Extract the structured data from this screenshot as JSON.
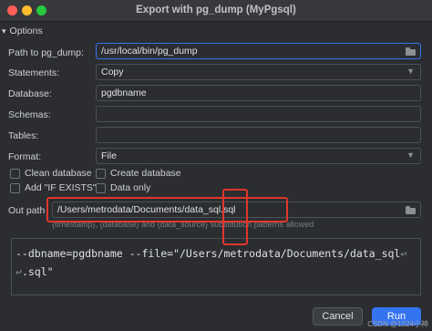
{
  "window": {
    "title": "Export with pg_dump (MyPgsql)"
  },
  "options": {
    "label": "Options",
    "caret": "▾"
  },
  "fields": {
    "path_to_pg_dump": {
      "label": "Path to pg_dump:",
      "value": "/usr/local/bin/pg_dump"
    },
    "statements": {
      "label": "Statements:",
      "value": "Copy"
    },
    "database": {
      "label": "Database:",
      "value": "pgdbname"
    },
    "schemas": {
      "label": "Schemas:",
      "value": ""
    },
    "tables": {
      "label": "Tables:",
      "value": ""
    },
    "format": {
      "label": "Format:",
      "value": "File"
    }
  },
  "checkboxes": {
    "clean_database": {
      "label": "Clean database",
      "checked": false
    },
    "create_database": {
      "label": "Create database",
      "checked": false
    },
    "if_exists": {
      "label": "Add \"IF EXISTS\"",
      "checked": false
    },
    "data_only": {
      "label": "Data only",
      "checked": false
    }
  },
  "out_path": {
    "label": "Out path",
    "value": "/Users/metrodata/Documents/data_sql.sql",
    "hint": "{timestamp}, {database} and {data_source} substitution patterns allowed"
  },
  "command": {
    "line1": "--dbname=pgdbname --file=\"/Users/metrodata/Documents/data_sql",
    "line2": ".sql\"",
    "wrap_glyph": "↩"
  },
  "buttons": {
    "cancel": "Cancel",
    "run": "Run"
  },
  "icons": {
    "folder": "folder-icon",
    "dropdown": "chevron-down-icon"
  },
  "colors": {
    "accent": "#3574f0",
    "highlight": "#e0362c",
    "background": "#2b2d30"
  },
  "watermark": "CSDN @1024小神"
}
